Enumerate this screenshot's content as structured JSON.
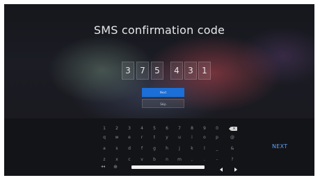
{
  "title": "SMS confirmation code",
  "code_digits": [
    "3",
    "7",
    "5",
    "",
    "4",
    "3",
    "1"
  ],
  "buttons": {
    "next": "Next",
    "skip": "Skip"
  },
  "keyboard": {
    "row1": [
      "1",
      "2",
      "3",
      "4",
      "5",
      "6",
      "7",
      "8",
      "9",
      "0"
    ],
    "row2": [
      "q",
      "w",
      "e",
      "r",
      "t",
      "y",
      "u",
      "i",
      "o",
      "p",
      "@"
    ],
    "row3": [
      "a",
      "s",
      "d",
      "f",
      "g",
      "h",
      "j",
      "k",
      "l",
      "_",
      "&"
    ],
    "row4": [
      "z",
      "x",
      "c",
      "v",
      "b",
      "n",
      "m",
      ",",
      ".",
      "-",
      "?"
    ],
    "backspace_glyph": "×",
    "next_label": "NEXT",
    "mic_glyph": "◂◂",
    "globe_glyph": "⊕"
  },
  "colors": {
    "accent": "#1b6fd6",
    "next_key": "#5da0f2"
  }
}
